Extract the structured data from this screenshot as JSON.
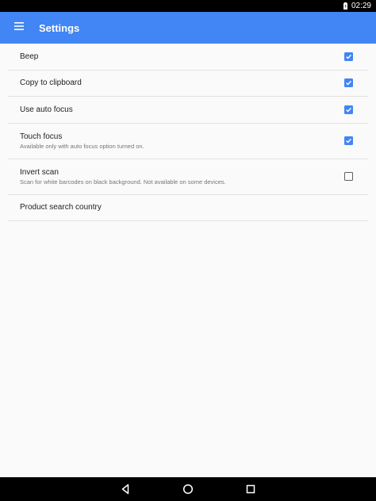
{
  "status_bar": {
    "time": "02:29",
    "icons": [
      "battery-icon"
    ]
  },
  "app_bar": {
    "title": "Settings",
    "menu_icon": "hamburger-menu-icon"
  },
  "preferences": [
    {
      "title": "Beep",
      "checked": true
    },
    {
      "title": "Copy to clipboard",
      "checked": true
    },
    {
      "title": "Use auto focus",
      "checked": true
    },
    {
      "title": "Touch focus",
      "summary": "Available only with auto focus option turned on.",
      "checked": true
    },
    {
      "title": "Invert scan",
      "summary": "Scan for white barcodes on black background. Not available on some devices.",
      "checked": false
    },
    {
      "title": "Product search country"
    }
  ],
  "nav_bar": {
    "icons": [
      "back-icon",
      "home-icon",
      "recents-icon"
    ]
  },
  "colors": {
    "accent": "#4285f4",
    "background": "#fafafa",
    "divider": "#e2e2e2"
  }
}
